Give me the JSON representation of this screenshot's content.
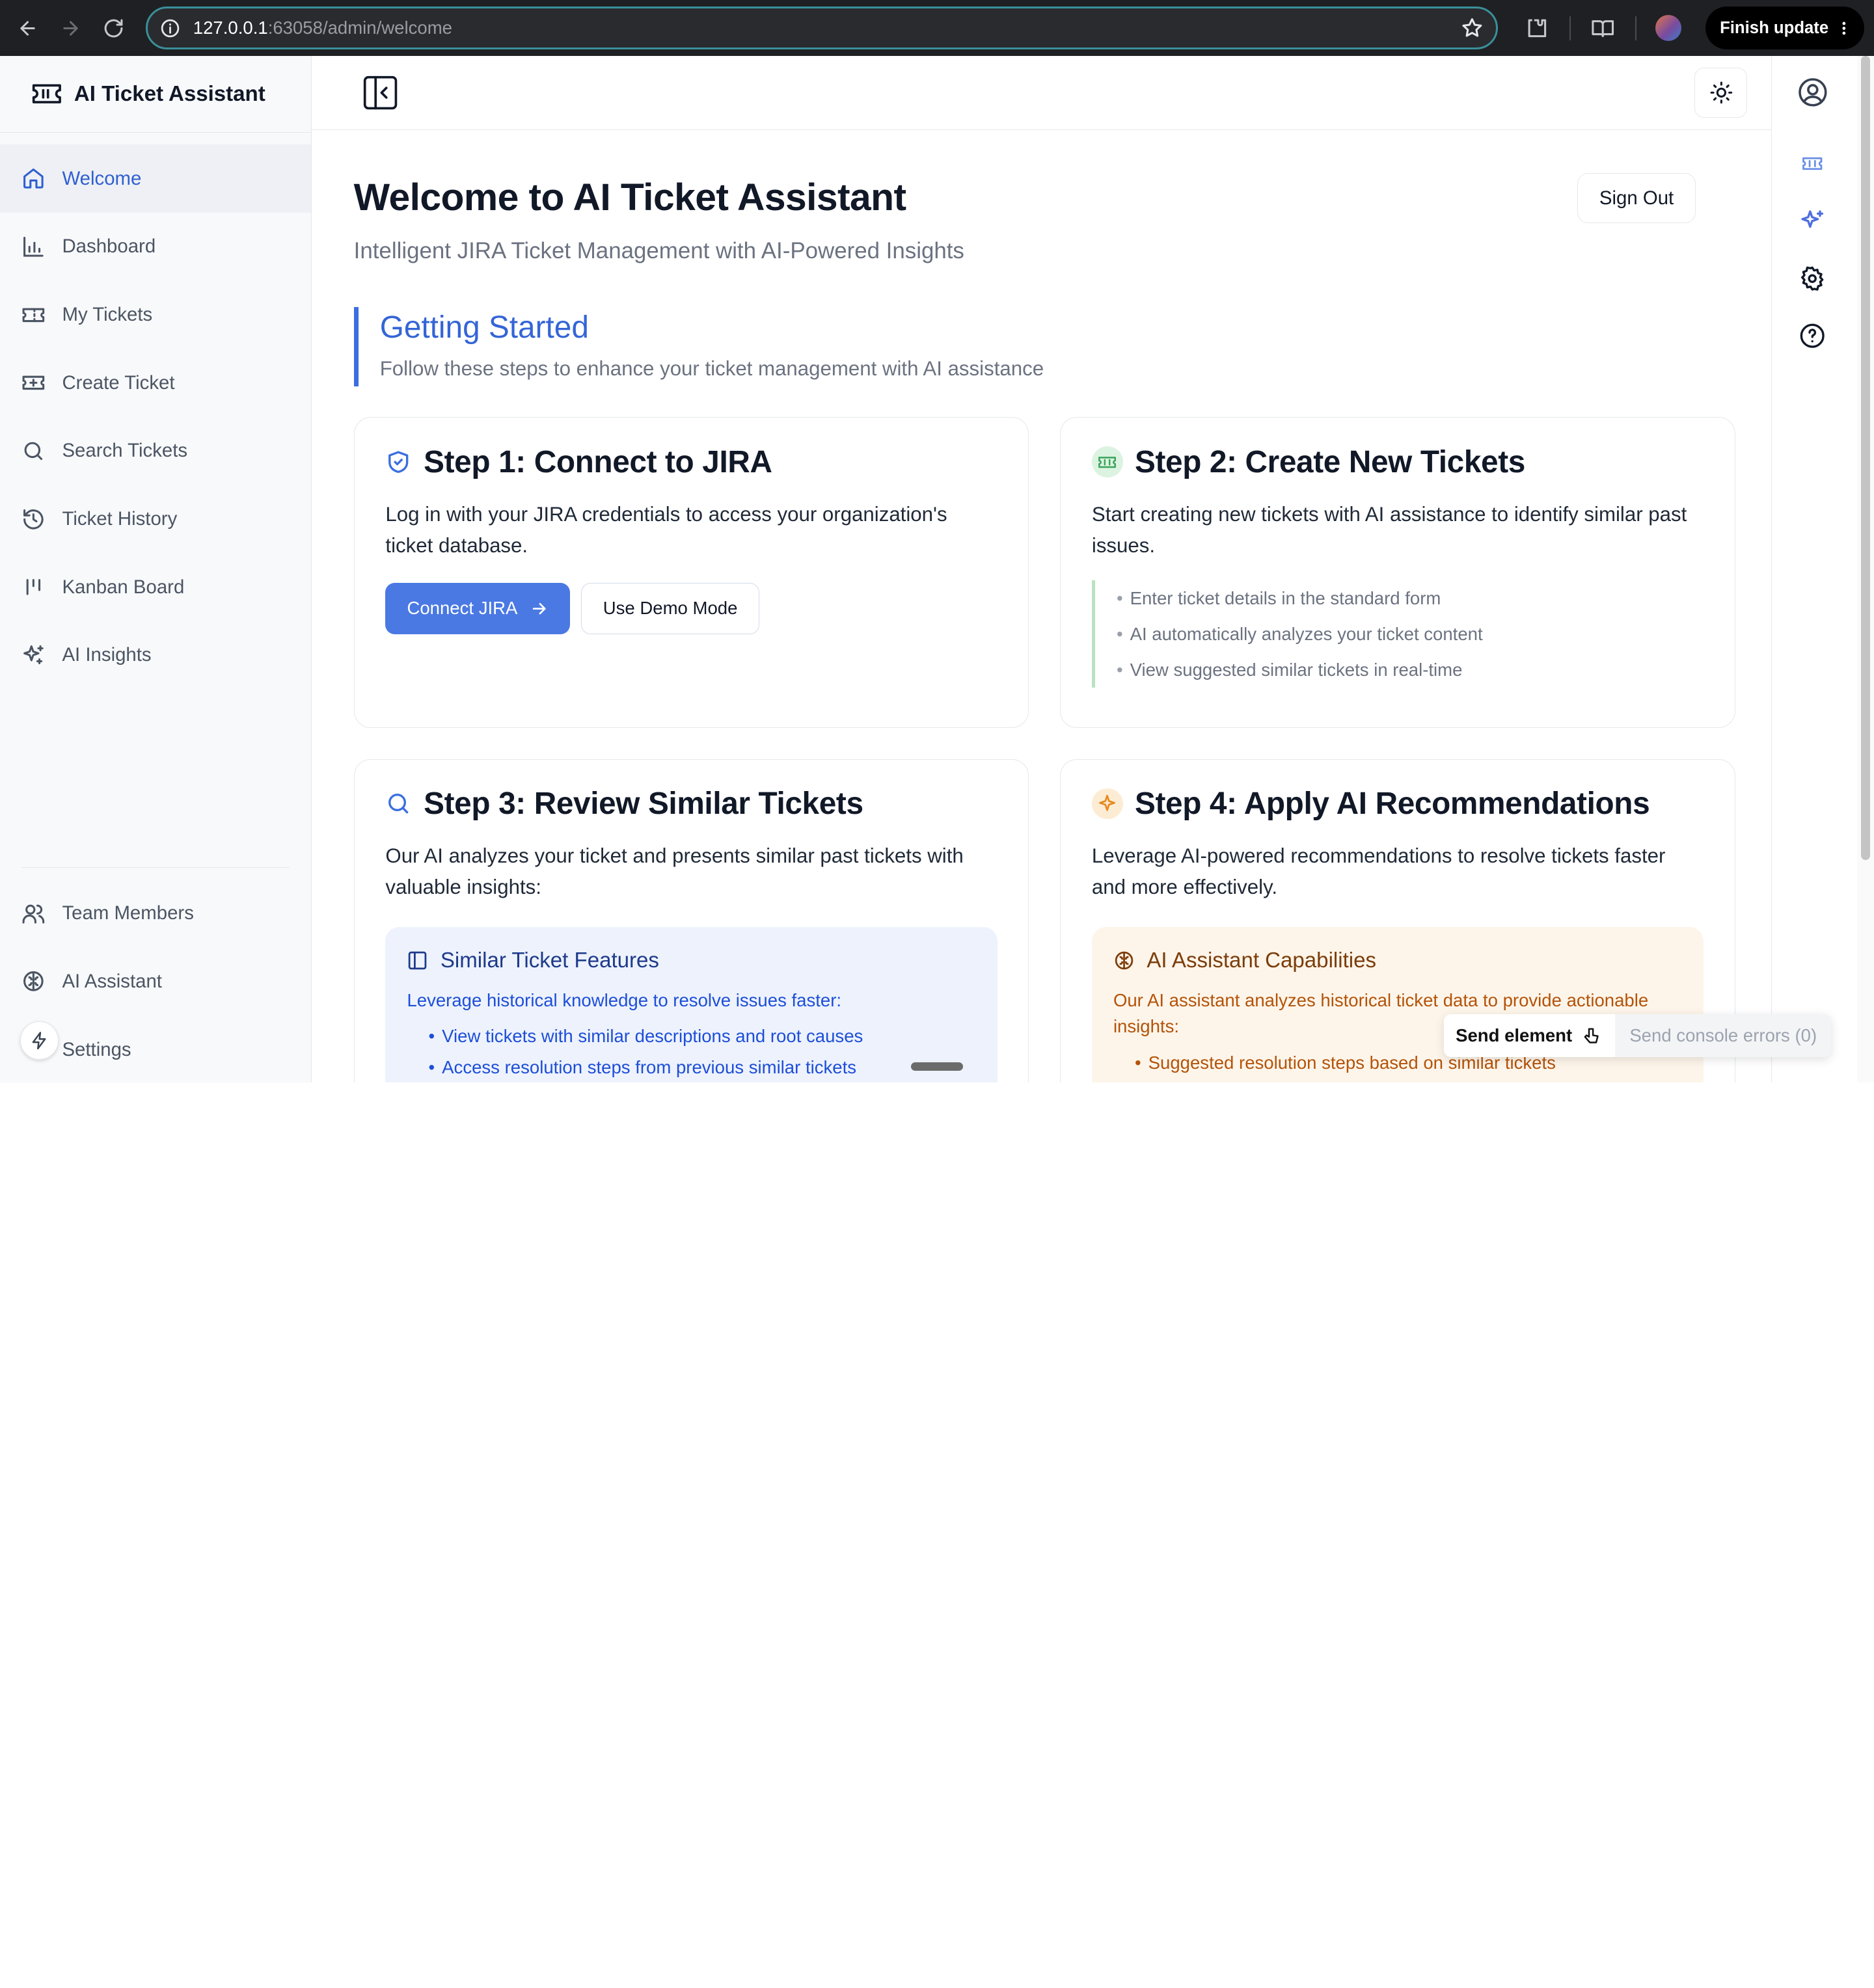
{
  "browser": {
    "url_host": "127.0.0.1",
    "url_path": ":63058/admin/welcome",
    "finish_update_label": "Finish update"
  },
  "sidebar": {
    "brand": "AI Ticket Assistant",
    "items": [
      {
        "label": "Welcome",
        "icon": "home-icon",
        "active": true
      },
      {
        "label": "Dashboard",
        "icon": "bar-chart-icon"
      },
      {
        "label": "My Tickets",
        "icon": "ticket-icon"
      },
      {
        "label": "Create Ticket",
        "icon": "ticket-plus-icon"
      },
      {
        "label": "Search Tickets",
        "icon": "search-icon"
      },
      {
        "label": "Ticket History",
        "icon": "history-icon"
      },
      {
        "label": "Kanban Board",
        "icon": "kanban-icon"
      },
      {
        "label": "AI Insights",
        "icon": "sparkles-icon"
      }
    ],
    "bottom_items": [
      {
        "label": "Team Members",
        "icon": "users-icon"
      },
      {
        "label": "AI Assistant",
        "icon": "brain-icon"
      },
      {
        "label": "Settings",
        "icon": "settings-icon"
      }
    ]
  },
  "main": {
    "title": "Welcome to AI Ticket Assistant",
    "subtitle": "Intelligent JIRA Ticket Management with AI-Powered Insights",
    "sign_out_label": "Sign Out",
    "getting_started": {
      "title": "Getting Started",
      "subtitle": "Follow these steps to enhance your ticket management with AI assistance"
    },
    "steps": [
      {
        "title": "Step 1: Connect to JIRA",
        "icon": "shield-check-icon",
        "description": "Log in with your JIRA credentials to access your organization's ticket database.",
        "primary_button": "Connect JIRA",
        "secondary_button": "Use Demo Mode"
      },
      {
        "title": "Step 2: Create New Tickets",
        "icon": "ticket-icon",
        "description": "Start creating new tickets with AI assistance to identify similar past issues.",
        "bullets": [
          "Enter ticket details in the standard form",
          "AI automatically analyzes your ticket content",
          "View suggested similar tickets in real-time"
        ]
      },
      {
        "title": "Step 3: Review Similar Tickets",
        "icon": "search-icon",
        "description": "Our AI analyzes your ticket and presents similar past tickets with valuable insights:",
        "feature": {
          "title": "Similar Ticket Features",
          "description": "Leverage historical knowledge to resolve issues faster:",
          "items": [
            "View tickets with similar descriptions and root causes",
            "Access resolution steps from previous similar tickets"
          ]
        }
      },
      {
        "title": "Step 4: Apply AI Recommendations",
        "icon": "sparkles-icon",
        "description": "Leverage AI-powered recommendations to resolve tickets faster and more effectively.",
        "feature": {
          "title": "AI Assistant Capabilities",
          "description": "Our AI assistant analyzes historical ticket data to provide actionable insights:",
          "items": [
            "Suggested resolution steps based on similar tickets"
          ]
        }
      }
    ]
  },
  "devtools": {
    "send_element_label": "Send element",
    "send_console_label": "Send console errors (0)"
  },
  "colors": {
    "accent": "#3b6fe0",
    "primary_button": "#4a79e3",
    "step2_accent": "#b8e3c0",
    "feature_blue_bg": "#edf2fc",
    "feature_amber_bg": "#fdf5ea"
  }
}
